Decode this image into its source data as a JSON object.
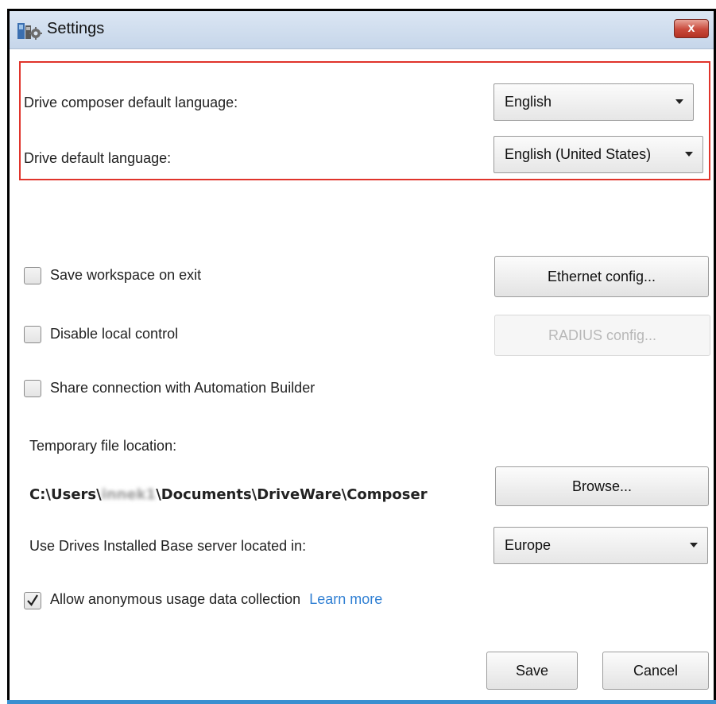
{
  "window": {
    "title": "Settings",
    "close_label": "x"
  },
  "language": {
    "composer_label": "Drive composer default language:",
    "composer_value": "English",
    "drive_label": "Drive default language:",
    "drive_value": "English (United States)"
  },
  "options": {
    "save_workspace_label": "Save workspace on exit",
    "save_workspace_checked": false,
    "disable_local_label": "Disable local control",
    "disable_local_checked": false,
    "share_connection_label": "Share connection with Automation Builder",
    "share_connection_checked": false
  },
  "buttons": {
    "ethernet_config": "Ethernet config...",
    "radius_config": "RADIUS config...",
    "browse": "Browse...",
    "save": "Save",
    "cancel": "Cancel"
  },
  "temp_file": {
    "label": "Temporary file location:",
    "path_prefix": "C:\\Users\\",
    "path_blurred": "innek1",
    "path_suffix": "\\Documents\\DriveWare\\Composer"
  },
  "server": {
    "label": "Use Drives Installed Base server located in:",
    "value": "Europe"
  },
  "usage": {
    "label": "Allow anonymous usage data collection",
    "checked": true,
    "learn_more": "Learn more"
  },
  "colors": {
    "highlight_border": "#e0342b",
    "link": "#2f7fd3",
    "titlebar": "#c6d6ea"
  }
}
